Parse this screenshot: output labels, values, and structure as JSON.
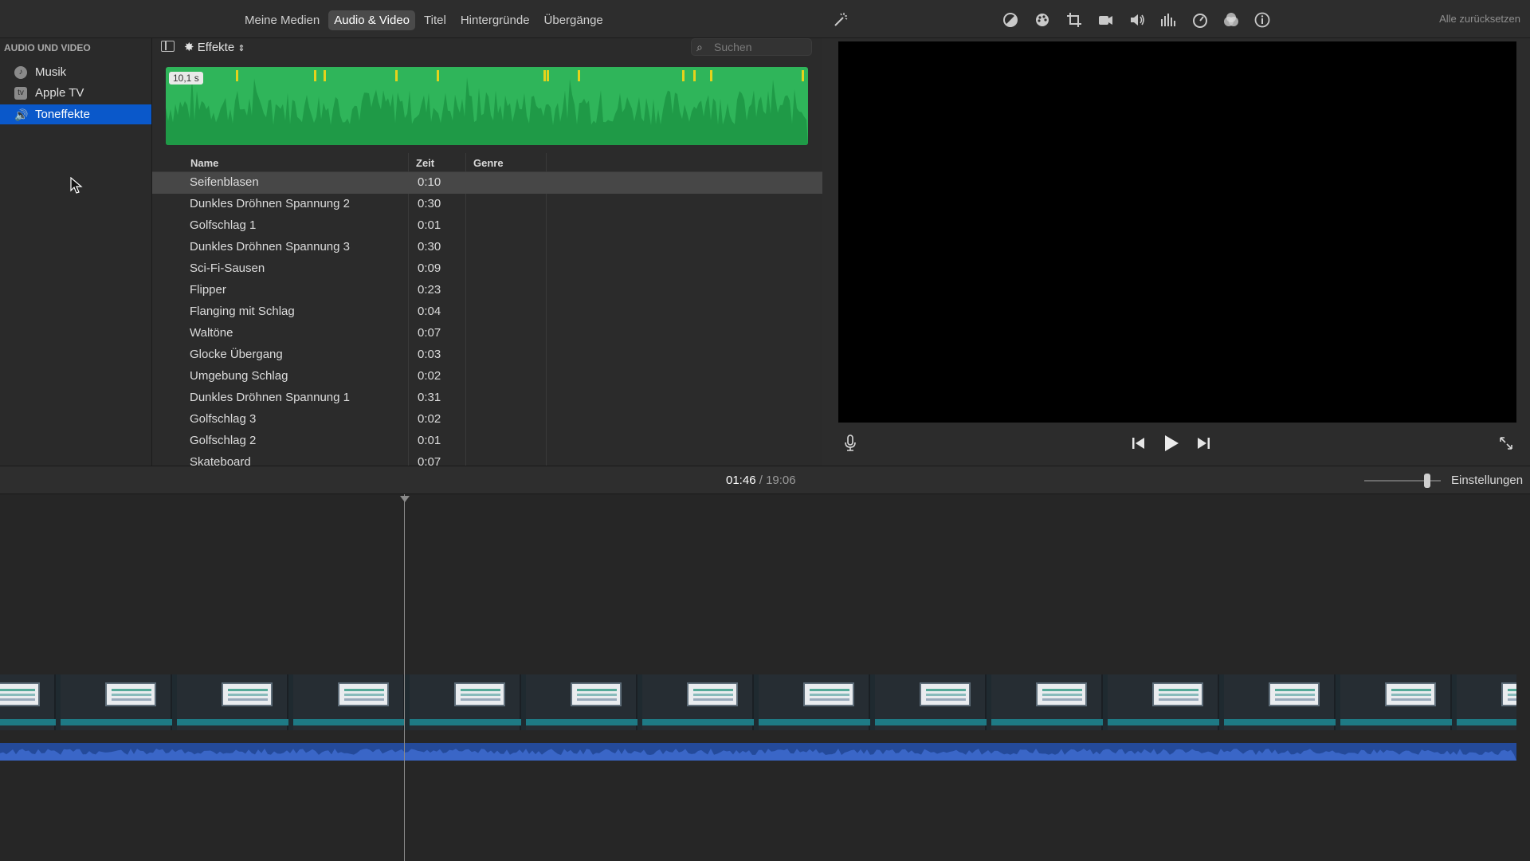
{
  "topbar": {
    "tabs": [
      {
        "label": "Meine Medien",
        "active": false
      },
      {
        "label": "Audio & Video",
        "active": true
      },
      {
        "label": "Titel",
        "active": false
      },
      {
        "label": "Hintergründe",
        "active": false
      },
      {
        "label": "Übergänge",
        "active": false
      }
    ]
  },
  "viewer_toolbar": {
    "icons": [
      "magic-wand-icon",
      "color-balance-icon",
      "color-correction-icon",
      "crop-icon",
      "stabilization-icon",
      "volume-icon",
      "equalizer-icon",
      "speed-icon",
      "filter-icon",
      "info-icon"
    ],
    "reset_label": "Alle zurücksetzen"
  },
  "sidebar": {
    "header": "AUDIO UND VIDEO",
    "items": [
      {
        "label": "Musik",
        "icon": "music-icon",
        "selected": false
      },
      {
        "label": "Apple TV",
        "icon": "apple-tv-icon",
        "selected": false
      },
      {
        "label": "Toneffekte",
        "icon": "speaker-icon",
        "selected": true
      }
    ]
  },
  "browser": {
    "effects_label": "Effekte",
    "search_placeholder": "Suchen",
    "wave_duration": "10,1 s",
    "columns": {
      "name": "Name",
      "time": "Zeit",
      "genre": "Genre"
    },
    "rows": [
      {
        "name": "Seifenblasen",
        "time": "0:10",
        "selected": true
      },
      {
        "name": "Dunkles Dröhnen Spannung 2",
        "time": "0:30"
      },
      {
        "name": "Golfschlag 1",
        "time": "0:01"
      },
      {
        "name": "Dunkles Dröhnen Spannung 3",
        "time": "0:30"
      },
      {
        "name": "Sci-Fi-Sausen",
        "time": "0:09"
      },
      {
        "name": "Flipper",
        "time": "0:23"
      },
      {
        "name": "Flanging mit Schlag",
        "time": "0:04"
      },
      {
        "name": "Waltöne",
        "time": "0:07"
      },
      {
        "name": "Glocke Übergang",
        "time": "0:03"
      },
      {
        "name": "Umgebung Schlag",
        "time": "0:02"
      },
      {
        "name": "Dunkles Dröhnen Spannung 1",
        "time": "0:31"
      },
      {
        "name": "Golfschlag 3",
        "time": "0:02"
      },
      {
        "name": "Golfschlag 2",
        "time": "0:01"
      },
      {
        "name": "Skateboard",
        "time": "0:07"
      }
    ]
  },
  "timeline": {
    "current": "01:46",
    "separator": "/",
    "total": "19:06",
    "settings_label": "Einstellungen"
  },
  "colors": {
    "accent": "#0a58ca",
    "waveform": "#2fb55a",
    "waveform_peak": "#e5d21c",
    "audio_track": "#244a9a"
  }
}
